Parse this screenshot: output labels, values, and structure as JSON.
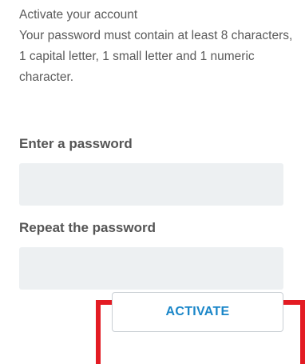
{
  "intro": {
    "title": "Activate your account",
    "message": "Your password must contain at least 8 characters, 1 capital letter, 1 small letter and 1 numeric character."
  },
  "form": {
    "password_label": "Enter a password",
    "password_value": "",
    "repeat_label": "Repeat the password",
    "repeat_value": "",
    "activate_label": "ACTIVATE"
  },
  "colors": {
    "accent": "#1a86c8",
    "highlight": "#e31b23",
    "field_bg": "#edf0f2"
  }
}
